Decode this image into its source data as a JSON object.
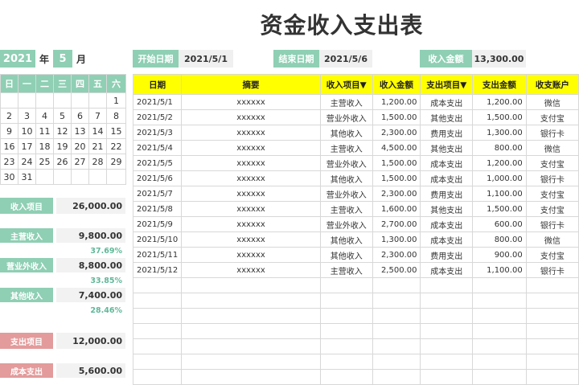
{
  "title": "资金收入支出表",
  "year": "2021",
  "year_label": "年",
  "month": "5",
  "month_label": "月",
  "start_date_label": "开始日期",
  "start_date": "2021/5/1",
  "end_date_label": "结束日期",
  "end_date": "2021/5/6",
  "income_amount_label": "收入金额",
  "income_amount": "13,300.00",
  "calendar": {
    "weekdays": [
      "日",
      "一",
      "二",
      "三",
      "四",
      "五",
      "六"
    ],
    "weeks": [
      [
        "",
        "",
        "",
        "",
        "",
        "",
        "1"
      ],
      [
        "2",
        "3",
        "4",
        "5",
        "6",
        "7",
        "8"
      ],
      [
        "9",
        "10",
        "11",
        "12",
        "13",
        "14",
        "15"
      ],
      [
        "16",
        "17",
        "18",
        "19",
        "20",
        "21",
        "22"
      ],
      [
        "23",
        "24",
        "25",
        "26",
        "27",
        "28",
        "29"
      ],
      [
        "30",
        "31",
        "",
        "",
        "",
        "",
        ""
      ]
    ]
  },
  "stats": {
    "income_item_label": "收入项目",
    "income_total": "26,000.00",
    "main_income_label": "主营收入",
    "main_income": "9,800.00",
    "main_income_pct": "37.69%",
    "other_biz_label": "营业外收入",
    "other_biz": "8,800.00",
    "other_biz_pct": "33.85%",
    "other_income_label": "其他收入",
    "other_income": "7,400.00",
    "other_income_pct": "28.46%",
    "expense_item_label": "支出项目",
    "expense_total": "12,000.00",
    "cost_expense_label": "成本支出",
    "cost_expense": "5,600.00"
  },
  "table": {
    "headers": [
      "日期",
      "摘要",
      "收入项目▼",
      "收入金额",
      "支出项目▼",
      "支出金额",
      "收支账户"
    ],
    "rows": [
      [
        "2021/5/1",
        "xxxxxx",
        "主营收入",
        "1,200.00",
        "成本支出",
        "1,200.00",
        "微信"
      ],
      [
        "2021/5/2",
        "xxxxxx",
        "营业外收入",
        "1,500.00",
        "其他支出",
        "1,500.00",
        "支付宝"
      ],
      [
        "2021/5/3",
        "xxxxxx",
        "其他收入",
        "2,300.00",
        "费用支出",
        "1,300.00",
        "银行卡"
      ],
      [
        "2021/5/4",
        "xxxxxx",
        "主营收入",
        "4,500.00",
        "其他支出",
        "800.00",
        "微信"
      ],
      [
        "2021/5/5",
        "xxxxxx",
        "营业外收入",
        "1,500.00",
        "成本支出",
        "1,200.00",
        "支付宝"
      ],
      [
        "2021/5/6",
        "xxxxxx",
        "其他收入",
        "1,500.00",
        "成本支出",
        "1,000.00",
        "银行卡"
      ],
      [
        "2021/5/7",
        "xxxxxx",
        "营业外收入",
        "2,300.00",
        "费用支出",
        "1,100.00",
        "支付宝"
      ],
      [
        "2021/5/8",
        "xxxxxx",
        "主营收入",
        "1,600.00",
        "其他支出",
        "1,500.00",
        "支付宝"
      ],
      [
        "2021/5/9",
        "xxxxxx",
        "营业外收入",
        "2,700.00",
        "成本支出",
        "600.00",
        "银行卡"
      ],
      [
        "2021/5/10",
        "xxxxxx",
        "其他收入",
        "1,300.00",
        "成本支出",
        "800.00",
        "微信"
      ],
      [
        "2021/5/11",
        "xxxxxx",
        "其他收入",
        "2,300.00",
        "费用支出",
        "900.00",
        "支付宝"
      ],
      [
        "2021/5/12",
        "xxxxxx",
        "主营收入",
        "2,500.00",
        "成本支出",
        "1,100.00",
        "银行卡"
      ]
    ],
    "empty_rows": 7
  }
}
